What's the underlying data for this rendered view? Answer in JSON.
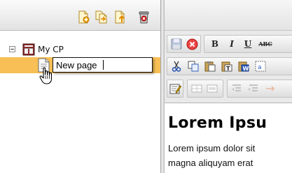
{
  "tree": {
    "root": {
      "label": "My CP"
    },
    "new_node": {
      "value": "New page"
    }
  },
  "left_toolbar": {
    "buttons": [
      "new-page-icon",
      "copy-page-icon",
      "move-page-icon",
      "delete-icon"
    ]
  },
  "editor": {
    "toolbar": {
      "bold": "B",
      "italic": "I",
      "underline": "U",
      "strikethrough": "ABC"
    },
    "content": {
      "heading": "Lorem Ipsu",
      "line1": "Lorem ipsum dolor sit",
      "line2": "magna aliquyam erat"
    }
  },
  "colors": {
    "selection": "#f7bf55",
    "toolbar_bg": "#e9e9e9"
  }
}
